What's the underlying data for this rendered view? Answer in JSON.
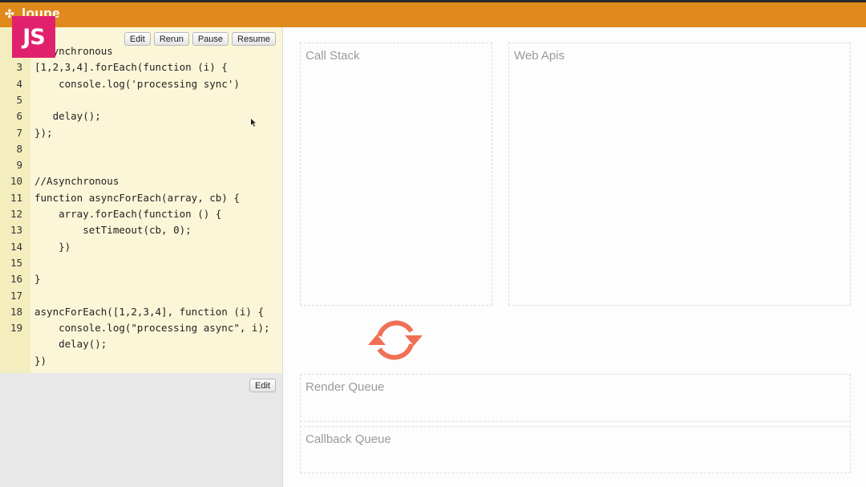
{
  "app": {
    "title": "loupe"
  },
  "badge": {
    "label": "JS"
  },
  "editor": {
    "toolbar": {
      "edit": "Edit",
      "rerun": "Rerun",
      "pause": "Pause",
      "resume": "Resume"
    },
    "lines": [
      {
        "num": "",
        "text": "//Synchronous"
      },
      {
        "num": "3",
        "text": "[1,2,3,4].forEach(function (i) {"
      },
      {
        "num": "4",
        "text": "    console.log('processing sync')"
      },
      {
        "num": "5",
        "text": ""
      },
      {
        "num": "6",
        "text": "   delay();"
      },
      {
        "num": "7",
        "text": "});"
      },
      {
        "num": "8",
        "text": ""
      },
      {
        "num": "9",
        "text": ""
      },
      {
        "num": "10",
        "text": "//Asynchronous"
      },
      {
        "num": "11",
        "text": "function asyncForEach(array, cb) {"
      },
      {
        "num": "12",
        "text": "    array.forEach(function () {"
      },
      {
        "num": "13",
        "text": "        setTimeout(cb, 0);"
      },
      {
        "num": "14",
        "text": "    })"
      },
      {
        "num": "15",
        "text": ""
      },
      {
        "num": "16",
        "text": "}"
      },
      {
        "num": "17",
        "text": ""
      },
      {
        "num": "18",
        "text": "asyncForEach([1,2,3,4], function (i) {"
      },
      {
        "num": "19",
        "text": "    console.log(\"processing async\", i);"
      },
      {
        "num": "",
        "text": "    delay();"
      },
      {
        "num": "",
        "text": "})"
      }
    ],
    "bottom_edit": "Edit"
  },
  "panels": {
    "call_stack": "Call Stack",
    "web_apis": "Web Apis",
    "render_queue": "Render Queue",
    "callback_queue": "Callback Queue"
  },
  "colors": {
    "topbar": "#e0891c",
    "badge": "#e2216e",
    "loop": "#f07055"
  }
}
